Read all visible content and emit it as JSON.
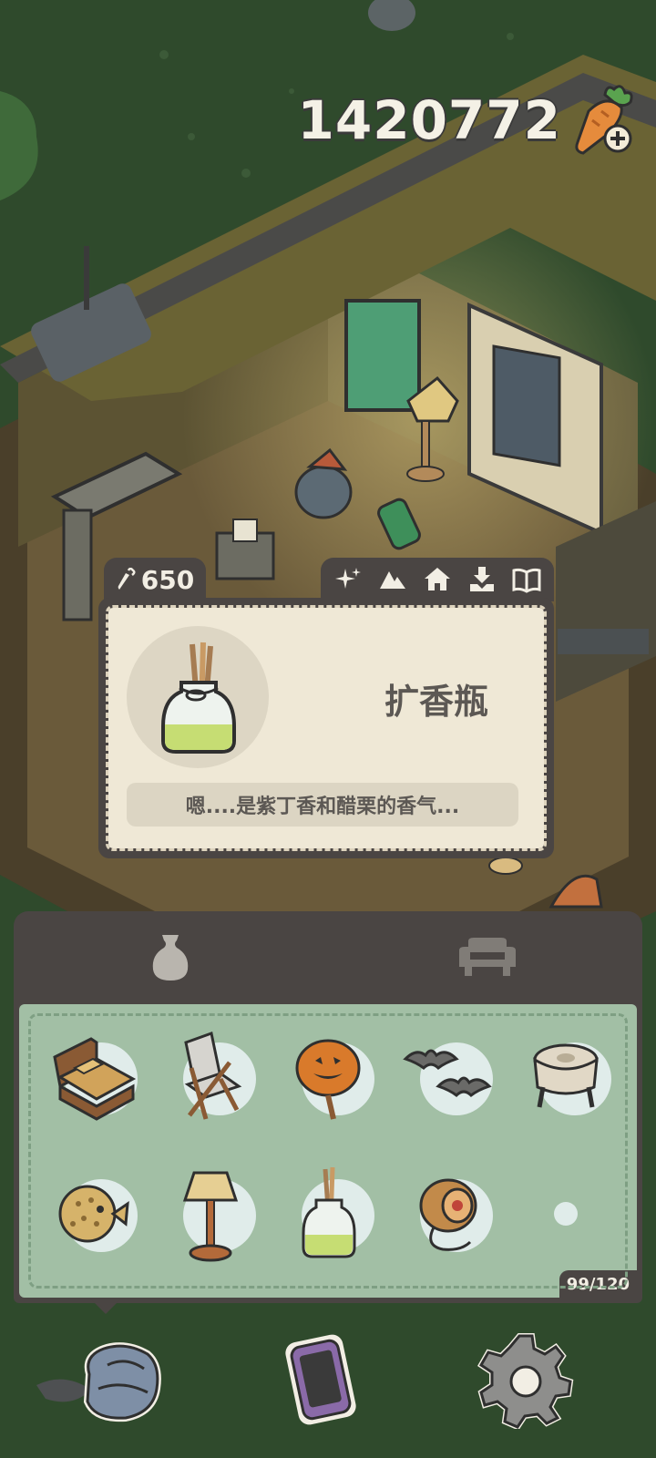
{
  "currency": {
    "value": "1420772",
    "icon": "carrot-plus-icon"
  },
  "item_card": {
    "price": "650",
    "price_icon": "carrot-icon",
    "name": "扩香瓶",
    "description": "嗯....是紫丁香和醋栗的香气...",
    "action_icons": [
      "sparkle-icon",
      "mountain-icon",
      "house-icon",
      "download-icon",
      "book-icon"
    ]
  },
  "inventory": {
    "tabs": [
      {
        "name": "vase-tab",
        "icon": "vase-icon",
        "active": true
      },
      {
        "name": "sofa-tab",
        "icon": "sofa-icon",
        "active": false
      }
    ],
    "items": [
      "bed-icon",
      "folding-chair-icon",
      "pumpkin-candy-apple-icon",
      "bats-icon",
      "stool-icon",
      "pufferfish-icon",
      "floor-lamp-icon",
      "diffuser-bottle-icon",
      "yoyo-icon",
      "empty-slot"
    ],
    "count": "99/120"
  },
  "nav": [
    "backpack-icon",
    "phone-icon",
    "settings-gear-icon"
  ],
  "colors": {
    "panel": "#4a4543",
    "grid": "#a2bfa5",
    "card": "#efe8d6",
    "grass": "#2f4a2c"
  }
}
